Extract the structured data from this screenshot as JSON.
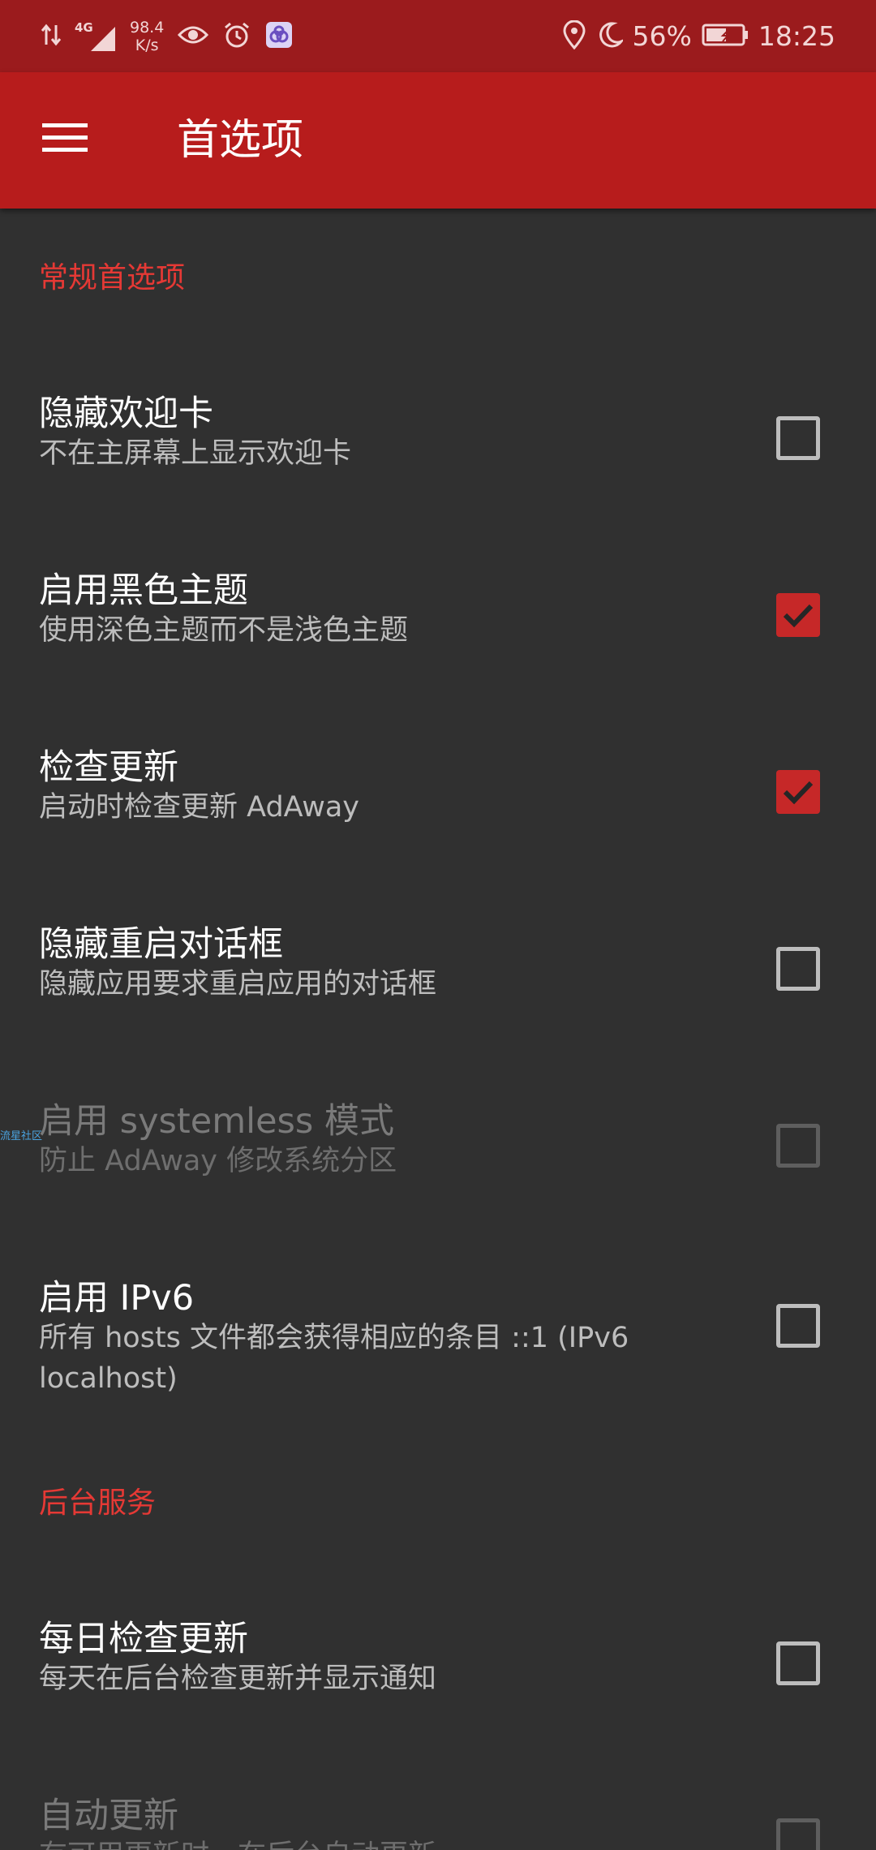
{
  "status_bar": {
    "network_type": "4G",
    "net_speed_value": "98.4",
    "net_speed_unit": "K/s",
    "battery": "56%",
    "time": "18:25",
    "icons": [
      "data-transfer-icon",
      "signal-icon",
      "eye-icon",
      "alarm-icon",
      "app-notification-icon",
      "location-icon",
      "moon-icon",
      "battery-icon"
    ]
  },
  "app_bar": {
    "title": "首选项",
    "menu_icon": "hamburger-menu-icon"
  },
  "sections": [
    {
      "header": "常规首选项",
      "items": [
        {
          "title": "隐藏欢迎卡",
          "summary": "不在主屏幕上显示欢迎卡",
          "checked": false,
          "enabled": true
        },
        {
          "title": "启用黑色主题",
          "summary": "使用深色主题而不是浅色主题",
          "checked": true,
          "enabled": true
        },
        {
          "title": "检查更新",
          "summary": "启动时检查更新 AdAway",
          "checked": true,
          "enabled": true
        },
        {
          "title": "隐藏重启对话框",
          "summary": "隐藏应用要求重启应用的对话框",
          "checked": false,
          "enabled": true
        },
        {
          "title": "启用 systemless 模式",
          "summary": "防止 AdAway 修改系统分区",
          "checked": false,
          "enabled": false
        },
        {
          "title": "启用 IPv6",
          "summary": "所有 hosts 文件都会获得相应的条目 ::1 (IPv6 localhost)",
          "checked": false,
          "enabled": true
        }
      ]
    },
    {
      "header": "后台服务",
      "items": [
        {
          "title": "每日检查更新",
          "summary": "每天在后台检查更新并显示通知",
          "checked": false,
          "enabled": true
        },
        {
          "title": "自动更新",
          "summary": "有可用更新时，在后台自动更新",
          "checked": false,
          "enabled": false
        }
      ]
    }
  ],
  "watermark": "流星社区",
  "colors": {
    "status_bar": "#9b1b1d",
    "app_bar": "#b71c1c",
    "background": "#303030",
    "accent": "#e53935",
    "checkbox_checked": "#c62828"
  }
}
